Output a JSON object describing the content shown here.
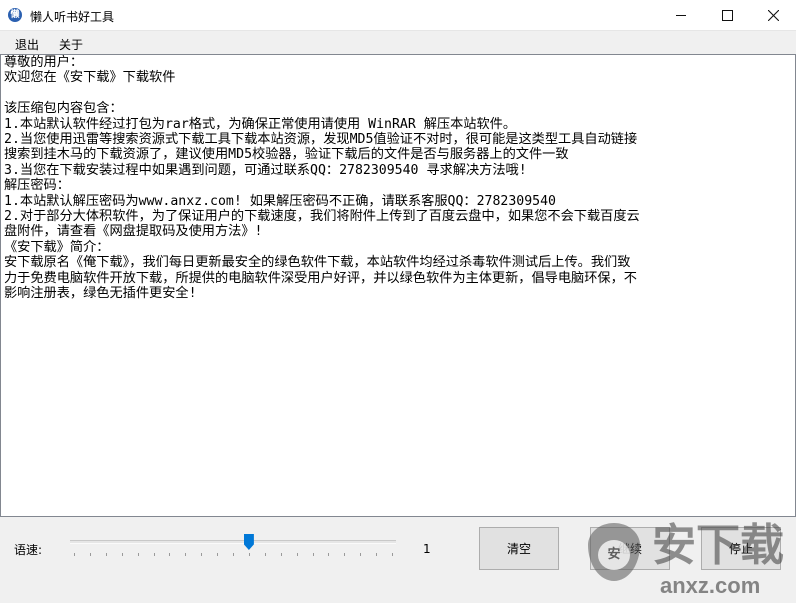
{
  "window": {
    "title": "懒人听书好工具",
    "icon": "app-icon",
    "controls": [
      "minimize-icon",
      "maximize-icon",
      "close-icon"
    ]
  },
  "menu": {
    "items": [
      {
        "label": "退出"
      },
      {
        "label": "关于"
      }
    ]
  },
  "editor": {
    "lines": [
      "尊敬的用户：",
      "欢迎您在《安下载》下载软件",
      "",
      "该压缩包内容包含：",
      "1.本站默认软件经过打包为rar格式，为确保正常使用请使用 WinRAR 解压本站软件。",
      "2.当您使用迅雷等搜索资源式下载工具下载本站资源，发现MD5值验证不对时，很可能是这类型工具自动链接",
      "搜索到挂木马的下载资源了，建议使用MD5校验器，验证下载后的文件是否与服务器上的文件一致",
      "3.当您在下载安装过程中如果遇到问题，可通过联系QQ：2782309540 寻求解决方法哦!",
      "解压密码：",
      "1.本站默认解压密码为www.anxz.com! 如果解压密码不正确，请联系客服QQ：2782309540",
      "2.对于部分大体积软件，为了保证用户的下载速度，我们将附件上传到了百度云盘中，如果您不会下载百度云",
      "盘附件，请查看《网盘提取码及使用方法》!",
      "《安下载》简介：",
      "安下载原名《俺下载》，我们每日更新最安全的绿色软件下载，本站软件均经过杀毒软件测试后上传。我们致",
      "力于免费电脑软件开放下载，所提供的电脑软件深受用户好评，并以绿色软件为主体更新，倡导电脑环保，不",
      "影响注册表，绿色无插件更安全!"
    ]
  },
  "controls": {
    "speed_label": "语速:",
    "speed_value": "1",
    "speed_fraction": 0.55,
    "clear_button": "清空",
    "continue_button": "继续",
    "stop_button": "停止"
  },
  "watermark": {
    "text_cn": "安下载",
    "text_en": "anxz.com",
    "shield_char": "安"
  },
  "colors": {
    "slider_thumb": "#0078d7",
    "editor_bg": "#ffffff",
    "window_bg": "#f0f0f0"
  }
}
